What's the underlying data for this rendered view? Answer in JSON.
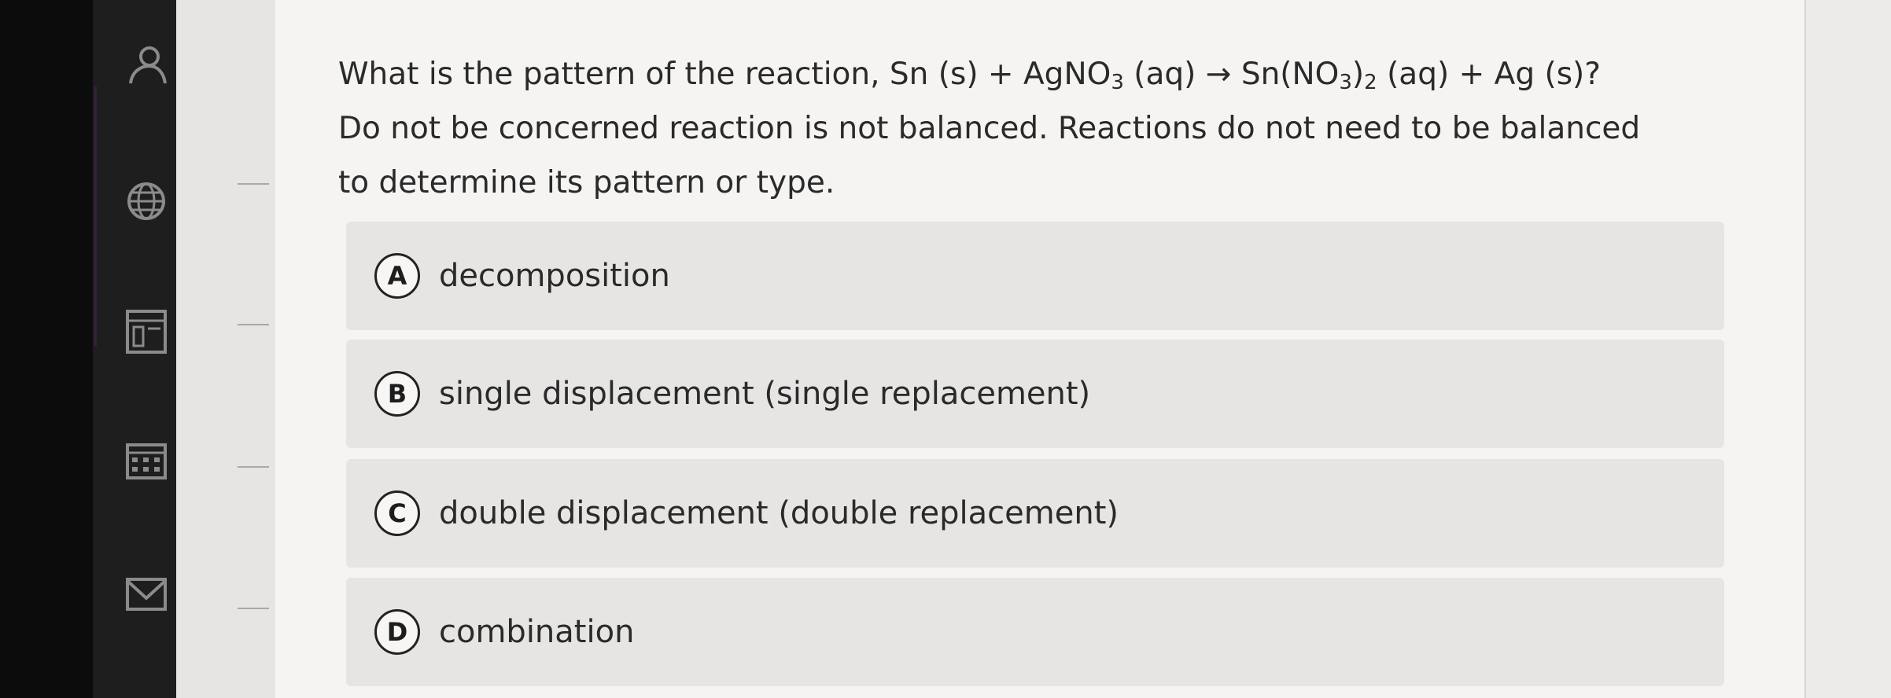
{
  "sidebar": {
    "icons": [
      "person-icon",
      "globe-icon",
      "gradebook-icon",
      "calendar-icon",
      "inbox-icon"
    ]
  },
  "question": {
    "line1_prefix": "What is the pattern of the reaction, Sn (s) + AgNO",
    "line1_sub1": "3",
    "line1_mid1": " (aq) → Sn(NO",
    "line1_sub2": "3",
    "line1_mid2": ")",
    "line1_sub3": "2",
    "line1_suffix": " (aq) + Ag (s)?",
    "line2": "Do not be concerned reaction is not balanced. Reactions do not need to be balanced",
    "line3": "to determine its pattern or type."
  },
  "options": [
    {
      "letter": "A",
      "text": "decomposition"
    },
    {
      "letter": "B",
      "text": "single displacement (single replacement)"
    },
    {
      "letter": "C",
      "text": "double displacement (double replacement)"
    },
    {
      "letter": "D",
      "text": "combination"
    }
  ],
  "colors": {
    "page": "#f5f4f2",
    "option_bg": "#e6e5e3",
    "sidebar": "#1e1e1f",
    "text": "#2a2a2a"
  }
}
